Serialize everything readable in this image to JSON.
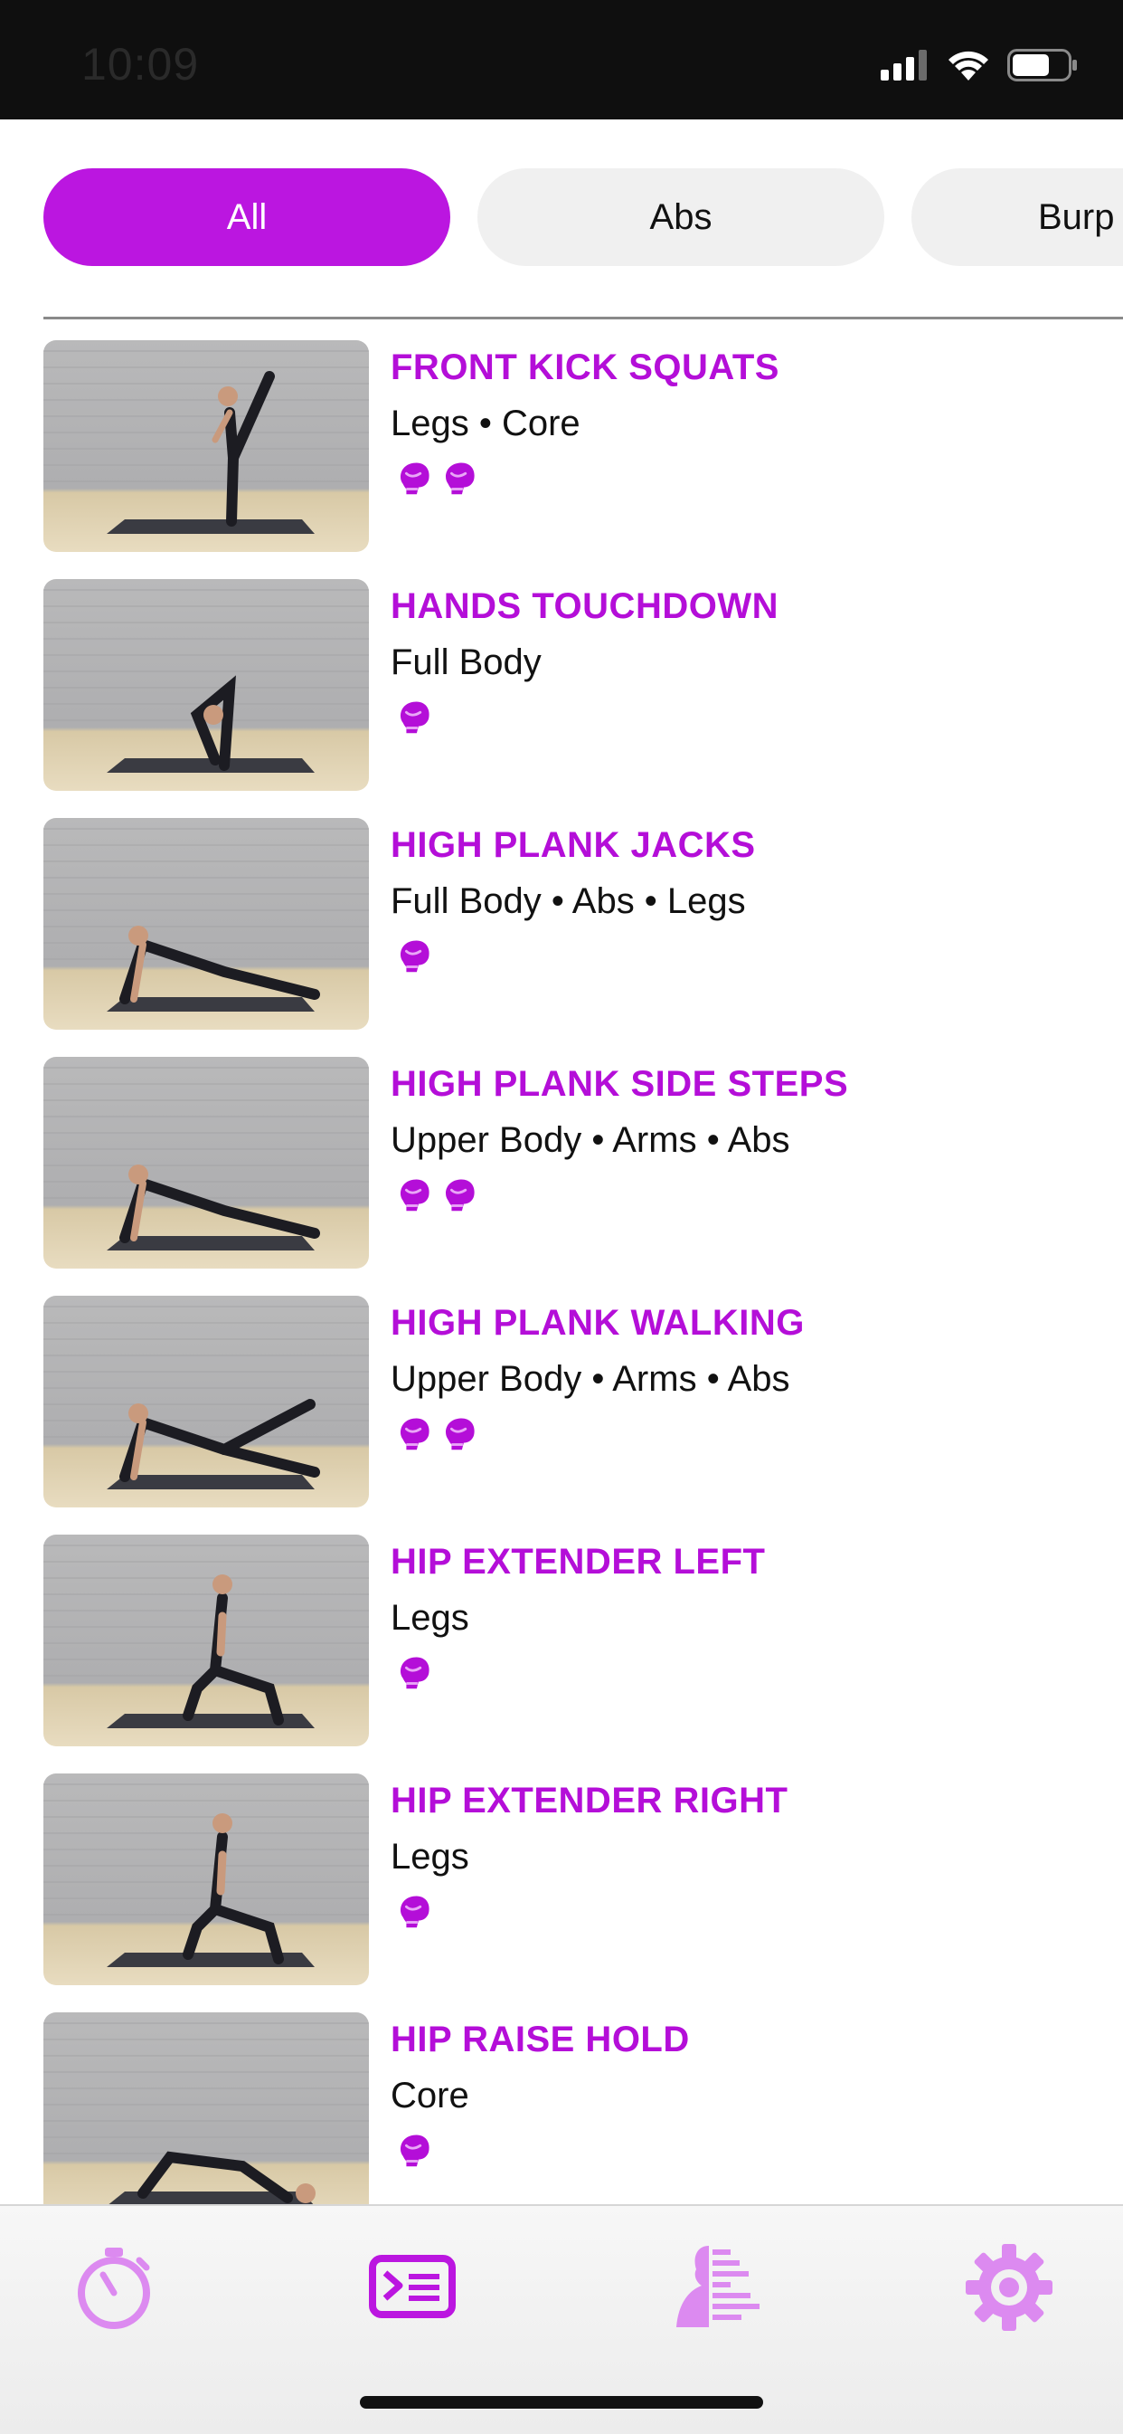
{
  "status": {
    "time": "10:09"
  },
  "filters": [
    {
      "label": "All",
      "active": true
    },
    {
      "label": "Abs",
      "active": false
    },
    {
      "label": "Burp",
      "active": false
    }
  ],
  "exercises": [
    {
      "name": "FRONT KICK SQUATS",
      "tags": "Legs • Core",
      "level": 2,
      "pose": "kick"
    },
    {
      "name": "HANDS TOUCHDOWN",
      "tags": "Full Body",
      "level": 1,
      "pose": "fold"
    },
    {
      "name": "HIGH PLANK JACKS",
      "tags": "Full Body • Abs • Legs",
      "level": 1,
      "pose": "plank"
    },
    {
      "name": "HIGH PLANK SIDE STEPS",
      "tags": "Upper Body • Arms • Abs",
      "level": 2,
      "pose": "plank"
    },
    {
      "name": "HIGH PLANK WALKING",
      "tags": "Upper Body • Arms • Abs",
      "level": 2,
      "pose": "plank-leg"
    },
    {
      "name": "HIP EXTENDER LEFT",
      "tags": "Legs",
      "level": 1,
      "pose": "lunge"
    },
    {
      "name": "HIP EXTENDER RIGHT",
      "tags": "Legs",
      "level": 1,
      "pose": "lunge"
    },
    {
      "name": "HIP RAISE HOLD",
      "tags": "Core",
      "level": 1,
      "pose": "bridge"
    }
  ],
  "tabs": [
    {
      "icon": "stopwatch-icon",
      "active": false
    },
    {
      "icon": "workout-list-icon",
      "active": true
    },
    {
      "icon": "profile-stats-icon",
      "active": false
    },
    {
      "icon": "gear-icon",
      "active": false
    }
  ],
  "colors": {
    "accent": "#bb16e0",
    "title": "#b40ed8",
    "tab_inactive": "#dc8af0"
  }
}
